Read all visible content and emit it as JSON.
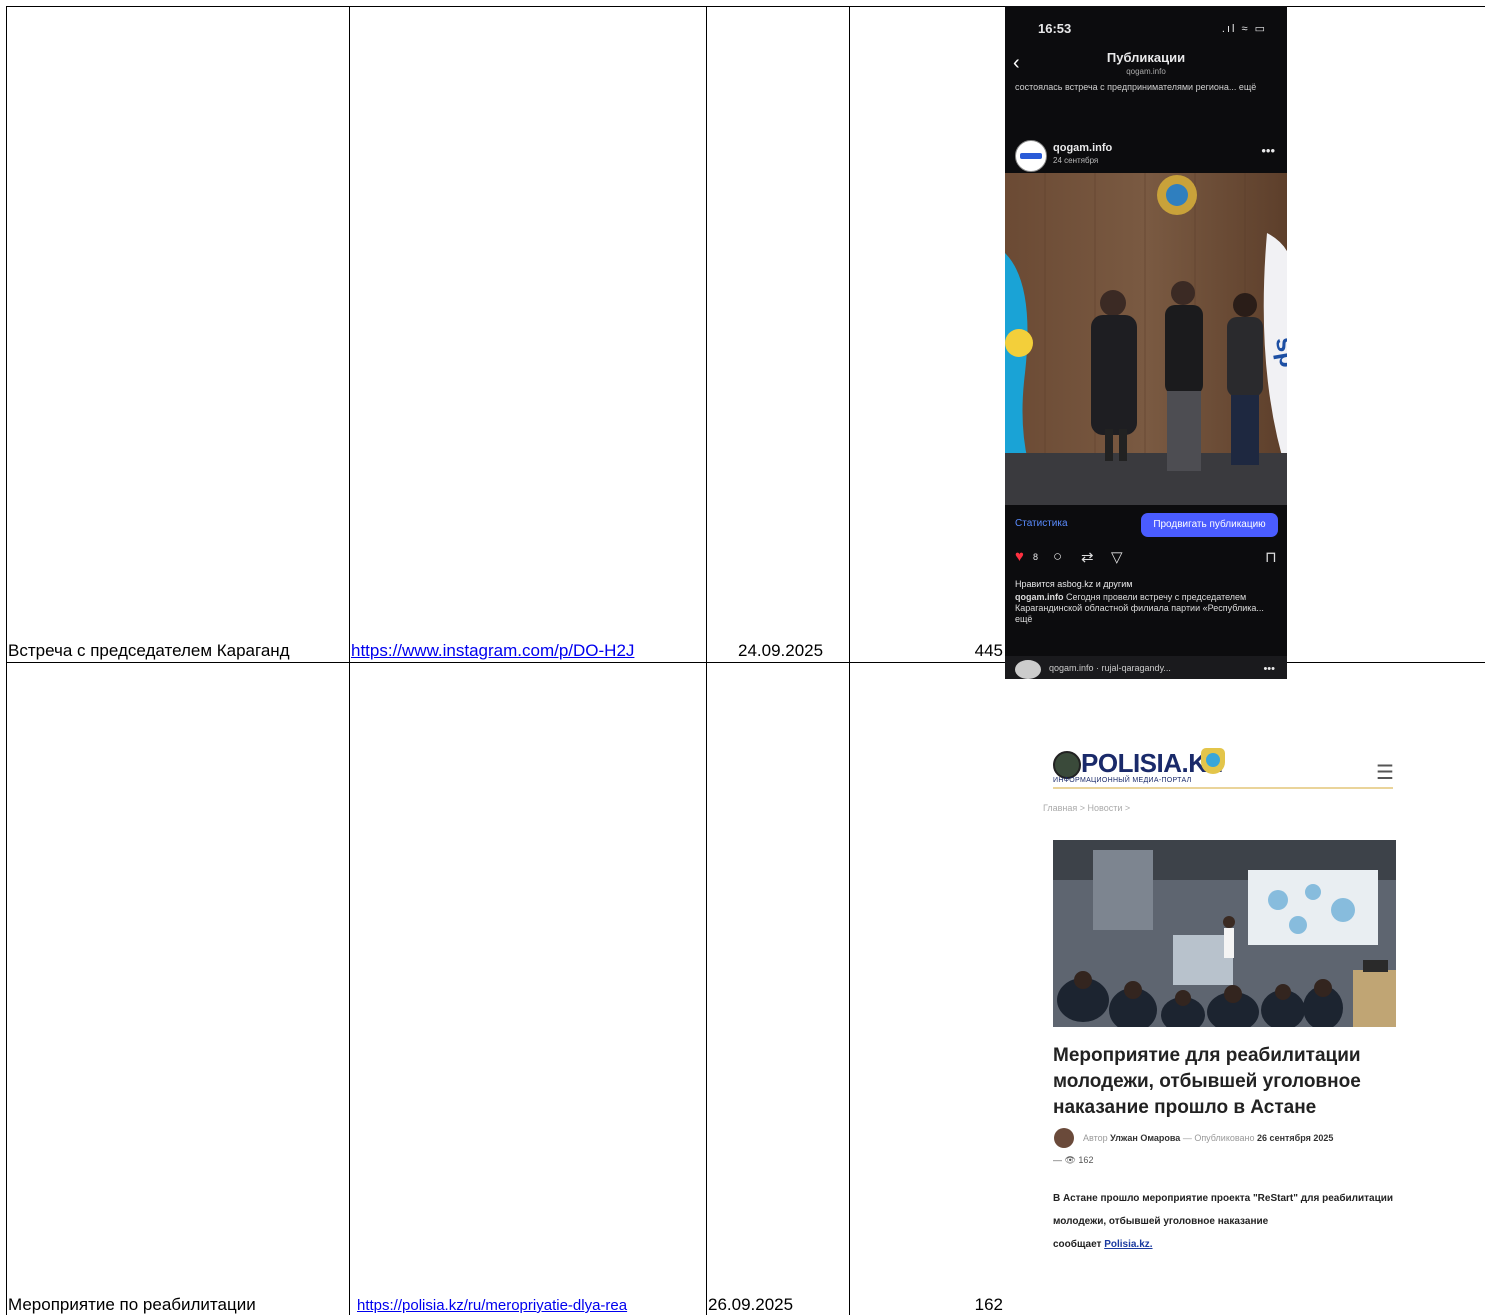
{
  "rows": [
    {
      "title": "Встреча с председателем Караганд",
      "link": "https://www.instagram.com/p/DO-H2J",
      "date": "24.09.2025",
      "views": "445"
    },
    {
      "title": "Мероприятие по реабилитации",
      "link": "https://polisia.kz/ru/meropriyatie-dlya-rea",
      "date": "26.09.2025",
      "views": "162"
    }
  ],
  "instagram": {
    "time": "16:53",
    "status_icons": ".ıl ≈ ▭",
    "header_title": "Публикации",
    "header_subtitle": "qogam.info",
    "prev_caption": "состоялась встреча с предпринимателями региона... ещё",
    "account": "qogam.info",
    "post_date": "24 сентября",
    "stats_label": "Статистика",
    "promote_label": "Продвигать публикацию",
    "like_count": "8",
    "liked_by": "Нравится asbog.kz и другим",
    "caption_author": "qogam.info",
    "caption": "Сегодня провели встречу с председателем Карагандинской областной филиала партии «Республика... ещё",
    "next_post": "qogam.info · rujal-qaragandy..."
  },
  "news": {
    "logo": "POLISIA.KZ",
    "tagline": "ИНФОРМАЦИОННЫЙ МЕДИА-ПОРТАЛ",
    "breadcrumb": "Главная > Новости >",
    "headline": "Мероприятие для реабилитации молодежи, отбывшей уголовное наказание прошло в Астане",
    "author_label": "Автор",
    "author": "Улжан Омарова",
    "published_label": "— Опубликовано",
    "published_date": "26 сентября 2025",
    "views": "— 👁 162",
    "body": "В Астане прошло мероприятие проекта \"ReStart\" для реабилитации молодежи, отбывшей уголовное наказание",
    "body_source_prefix": "сообщает",
    "body_source": "Polisia.kz."
  },
  "colors": {
    "link": "#0000ee",
    "ig_bg": "#0c0c0e",
    "ig_accent": "#4a5cff",
    "news_title": "#1a2a6a"
  }
}
